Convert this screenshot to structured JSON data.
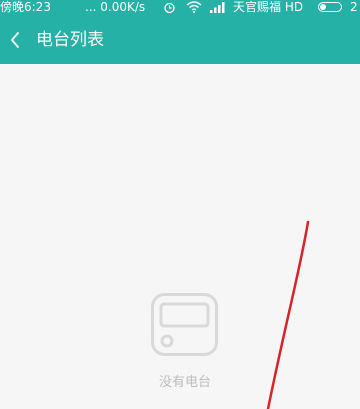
{
  "status_bar": {
    "time": "傍晚6:23",
    "net_speed": "... 0.00K/s",
    "carrier": "天官赐福 HD",
    "edge_text": "2"
  },
  "header": {
    "title": "电台列表"
  },
  "empty_state": {
    "message": "没有电台"
  },
  "colors": {
    "primary": "#26b1a6",
    "background": "#f6f6f6",
    "empty_icon": "#d9d9d9",
    "annotation": "#d8232a"
  }
}
